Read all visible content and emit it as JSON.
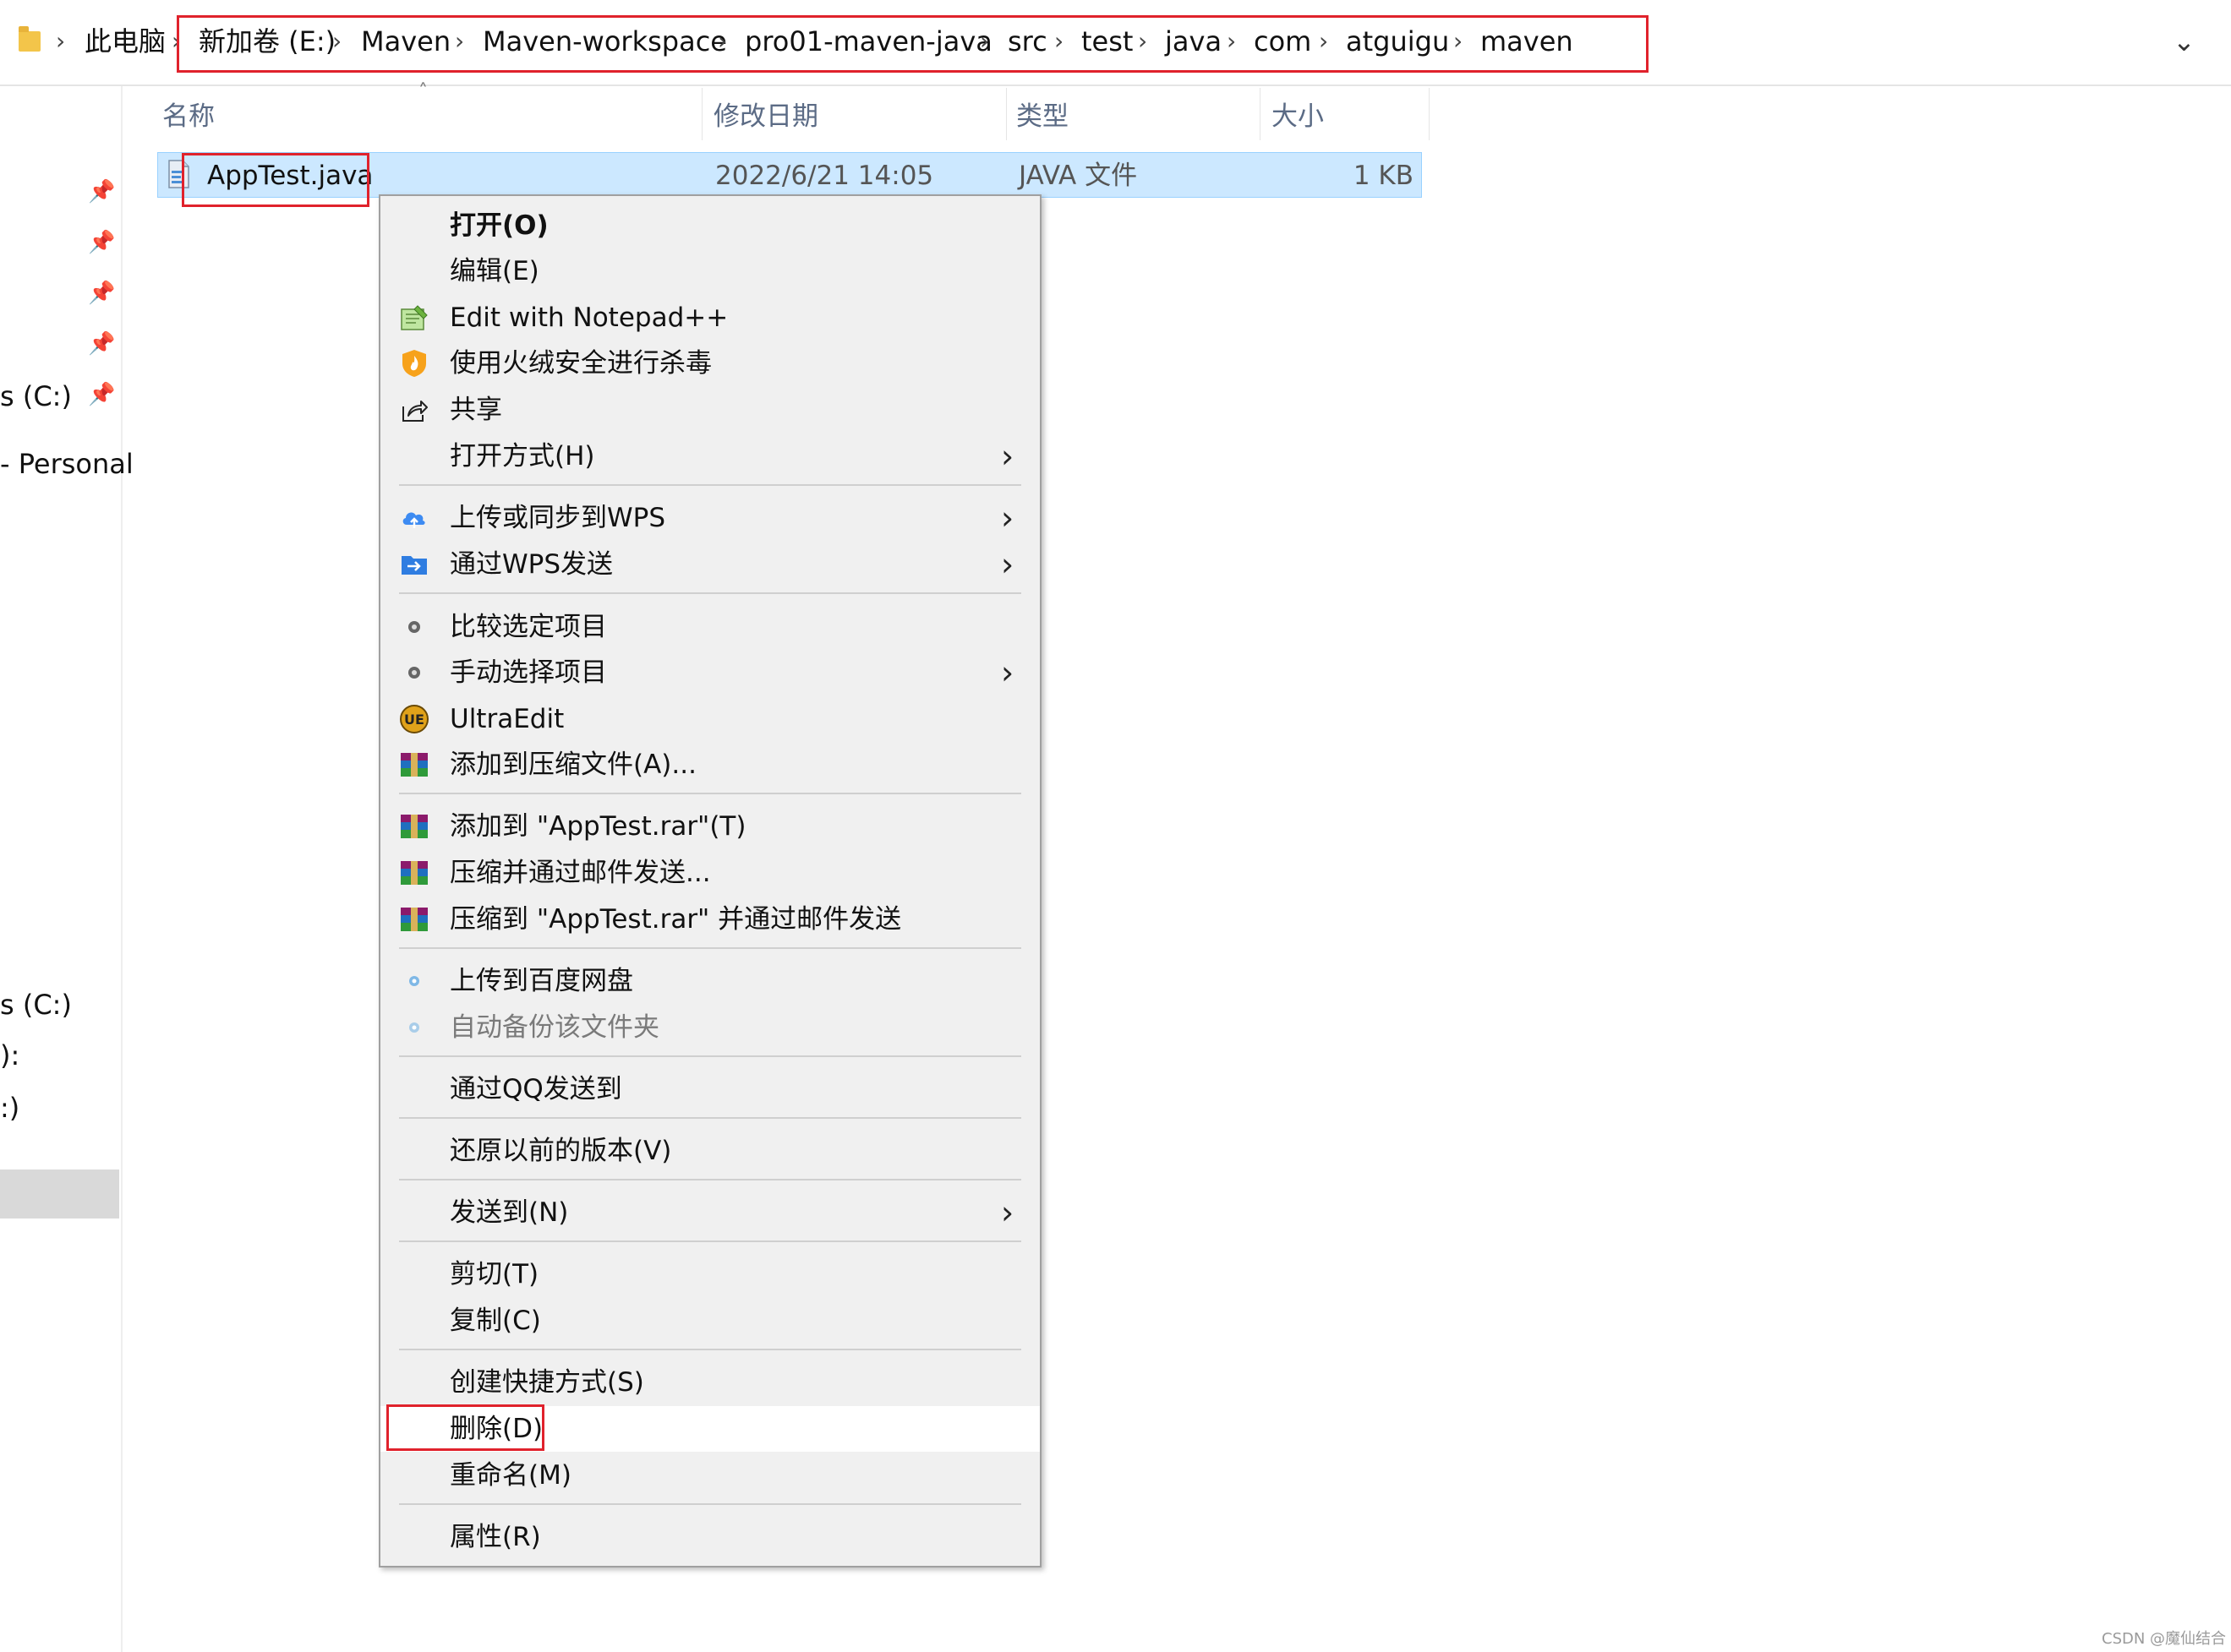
{
  "address_bar": {
    "crumbs": [
      "此电脑",
      "新加卷 (E:)",
      "Maven",
      "Maven-workspace",
      "pro01-maven-java",
      "src",
      "test",
      "java",
      "com",
      "atguigu",
      "maven"
    ],
    "separator": "›",
    "dropdown": "⌄"
  },
  "nav_pane": {
    "items": [
      "s (C:)",
      "- Personal",
      "s (C:)",
      "):",
      ":)"
    ],
    "pin_icon": "📌"
  },
  "columns": {
    "name": "名称",
    "date": "修改日期",
    "type": "类型",
    "size": "大小",
    "sort_arrow": "˄"
  },
  "file": {
    "name": "AppTest.java",
    "date": "2022/6/21 14:05",
    "type": "JAVA 文件",
    "size": "1 KB"
  },
  "context_menu": {
    "items": [
      {
        "label": "打开(O)",
        "icon": "",
        "submenu": false
      },
      {
        "label": "编辑(E)",
        "icon": "",
        "submenu": false
      },
      {
        "label": "Edit with Notepad++",
        "icon": "notepadpp-icon",
        "submenu": false
      },
      {
        "label": "使用火绒安全进行杀毒",
        "icon": "huorong-shield-icon",
        "submenu": false
      },
      {
        "label": "共享",
        "icon": "share-icon",
        "submenu": false
      },
      {
        "label": "打开方式(H)",
        "icon": "",
        "submenu": true
      },
      {
        "label": "上传或同步到WPS",
        "icon": "wps-cloud-icon",
        "submenu": true
      },
      {
        "label": "通过WPS发送",
        "icon": "wps-send-icon",
        "submenu": true
      },
      {
        "label": "比较选定项目",
        "icon": "compare-icon",
        "submenu": false
      },
      {
        "label": "手动选择项目",
        "icon": "select-icon",
        "submenu": true
      },
      {
        "label": "UltraEdit",
        "icon": "ultraedit-icon",
        "submenu": false
      },
      {
        "label": "添加到压缩文件(A)...",
        "icon": "winrar-icon",
        "submenu": false
      },
      {
        "label": "添加到 \"AppTest.rar\"(T)",
        "icon": "winrar-icon",
        "submenu": false
      },
      {
        "label": "压缩并通过邮件发送...",
        "icon": "winrar-icon",
        "submenu": false
      },
      {
        "label": "压缩到 \"AppTest.rar\" 并通过邮件发送",
        "icon": "winrar-icon",
        "submenu": false
      },
      {
        "label": "上传到百度网盘",
        "icon": "baidu-pan-icon",
        "submenu": false
      },
      {
        "label": "自动备份该文件夹",
        "icon": "baidu-backup-icon",
        "submenu": false,
        "disabled": true
      },
      {
        "label": "通过QQ发送到",
        "icon": "",
        "submenu": false
      },
      {
        "label": "还原以前的版本(V)",
        "icon": "",
        "submenu": false
      },
      {
        "label": "发送到(N)",
        "icon": "",
        "submenu": true
      },
      {
        "label": "剪切(T)",
        "icon": "",
        "submenu": false
      },
      {
        "label": "复制(C)",
        "icon": "",
        "submenu": false
      },
      {
        "label": "创建快捷方式(S)",
        "icon": "",
        "submenu": false
      },
      {
        "label": "删除(D)",
        "icon": "",
        "submenu": false,
        "highlighted": true
      },
      {
        "label": "重命名(M)",
        "icon": "",
        "submenu": false
      },
      {
        "label": "属性(R)",
        "icon": "",
        "submenu": false
      }
    ],
    "submenu_arrow": "›"
  },
  "colors": {
    "highlight_box": "#e0222c",
    "selection_bg": "#cce8ff",
    "menu_bg": "#f0f0f0"
  },
  "watermark": "CSDN @魔仙结合"
}
